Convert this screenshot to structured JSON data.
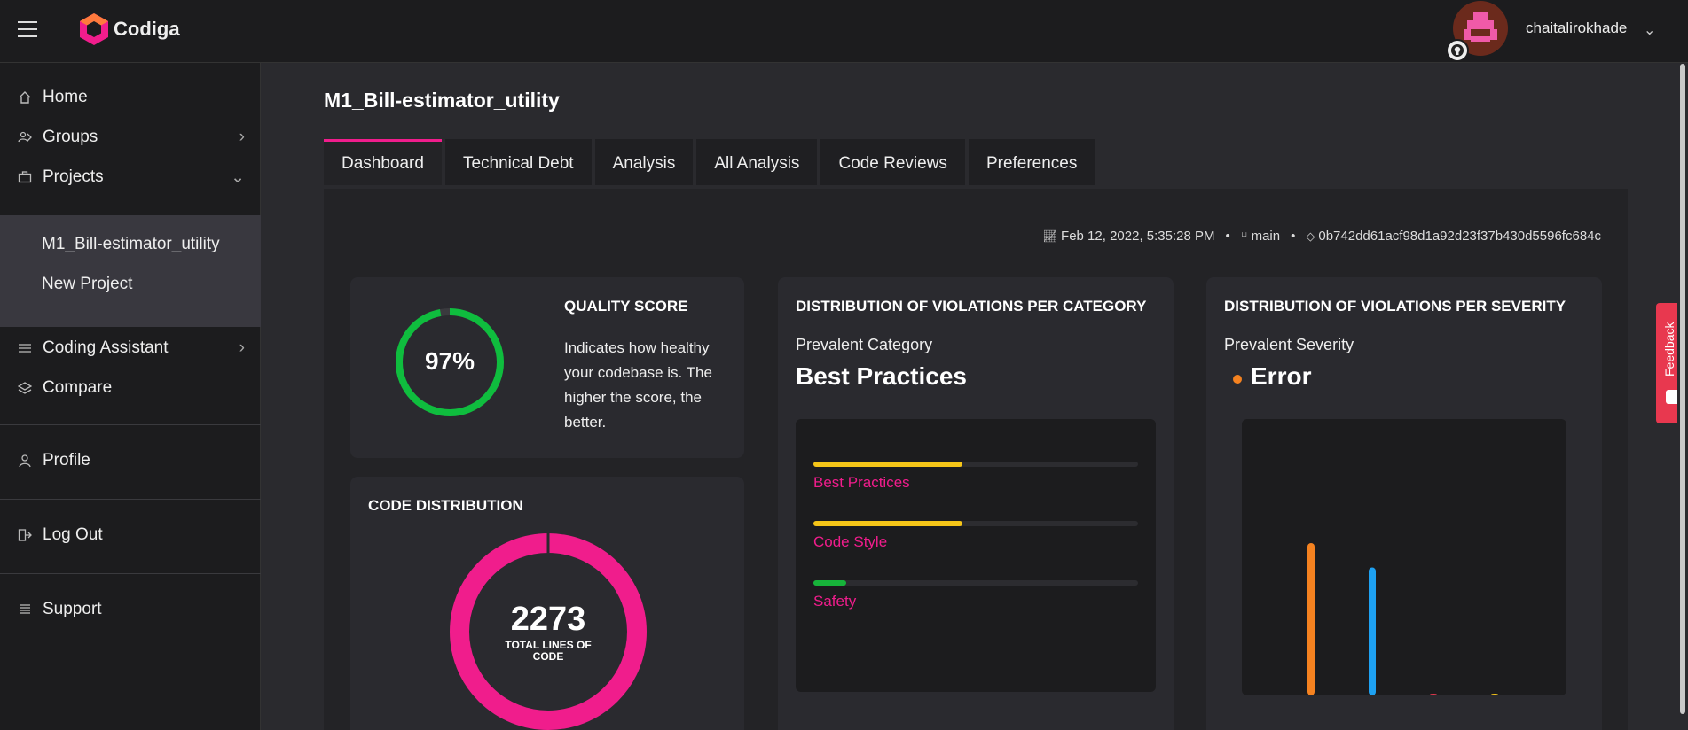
{
  "header": {
    "app_name": "Codiga",
    "username": "chaitalirokhade",
    "menu_icon": "hamburger-icon",
    "avatar_icon": "avatar",
    "badge_icon": "github-icon",
    "chevron_icon": "chevron-down-icon"
  },
  "sidebar": {
    "items": [
      {
        "label": "Home",
        "icon": "home-icon"
      },
      {
        "label": "Groups",
        "icon": "groups-icon"
      },
      {
        "label": "Projects",
        "icon": "briefcase-icon"
      },
      {
        "label": "Coding Assistant",
        "icon": "list-icon"
      },
      {
        "label": "Compare",
        "icon": "layers-icon"
      },
      {
        "label": "Profile",
        "icon": "user-icon"
      },
      {
        "label": "Log Out",
        "icon": "logout-icon"
      },
      {
        "label": "Support",
        "icon": "support-icon"
      }
    ],
    "projects": [
      "M1_Bill-estimator_utility",
      "New Project"
    ]
  },
  "page": {
    "title": "M1_Bill-estimator_utility",
    "tabs": [
      "Dashboard",
      "Technical Debt",
      "Analysis",
      "All Analysis",
      "Code Reviews",
      "Preferences"
    ],
    "active_tab": "Dashboard",
    "meta": {
      "date": "Feb 12, 2022, 5:35:28 PM",
      "branch": "main",
      "commit": "0b742dd61acf98d1a92d23f37b430d5596fc684c"
    }
  },
  "quality": {
    "title": "QUALITY SCORE",
    "score_label": "97%",
    "score": 97,
    "description": "Indicates how healthy your codebase is. The higher the score, the better.",
    "color": "#0fbd3e"
  },
  "code_distribution": {
    "title": "CODE DISTRIBUTION",
    "total": "2273",
    "total_label": "TOTAL LINES OF CODE",
    "color": "#f01d8c"
  },
  "category": {
    "title": "DISTRIBUTION OF VIOLATIONS PER CATEGORY",
    "prevalent_label": "Prevalent Category",
    "prevalent_value": "Best Practices",
    "bars": [
      {
        "label": "Best Practices",
        "fraction": 0.46,
        "color": "#f5c518"
      },
      {
        "label": "Code Style",
        "fraction": 0.46,
        "color": "#f5c518"
      },
      {
        "label": "Safety",
        "fraction": 0.1,
        "color": "#17b33a"
      }
    ]
  },
  "severity": {
    "title": "DISTRIBUTION OF VIOLATIONS PER SEVERITY",
    "prevalent_label": "Prevalent Severity",
    "prevalent_value": "Error",
    "dot_color": "#f58220",
    "chart_data": {
      "type": "bar",
      "values": [
        1,
        0.84,
        0.01,
        0.01
      ],
      "colors": [
        "#f58220",
        "#1ea1f2",
        "#e8384f",
        "#f5c518"
      ]
    }
  },
  "feedback": {
    "label": "Feedback",
    "color": "#e8384f"
  }
}
